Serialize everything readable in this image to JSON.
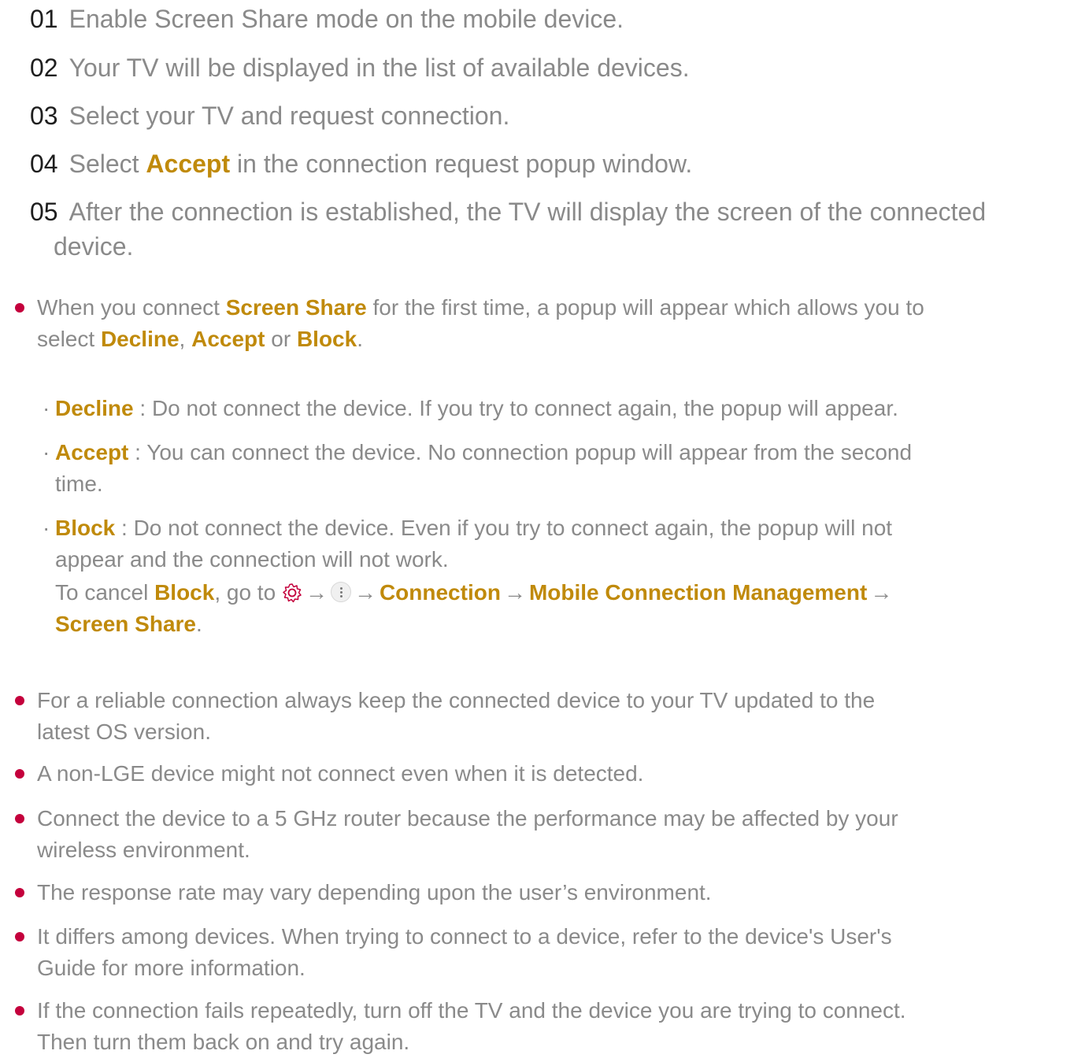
{
  "steps": [
    {
      "num": "01",
      "text": "Enable Screen Share mode on the mobile device."
    },
    {
      "num": "02",
      "text": "Your TV will be displayed in the list of available devices."
    },
    {
      "num": "03",
      "text": "Select your TV and request connection."
    },
    {
      "num": "04",
      "pre": "Select ",
      "bold": "Accept",
      "post": " in the connection request popup window."
    },
    {
      "num": "05",
      "line1": "After the connection is established, the TV will display the screen of the connected",
      "line2": "device."
    }
  ],
  "first_time_note": {
    "pre": "When you connect ",
    "b1": "Screen Share",
    "mid1": " for the first time, a popup will appear which allows you to",
    "mid2": "select ",
    "b2": "Decline",
    "sep1": ", ",
    "b3": "Accept",
    "sep2": " or ",
    "b4": "Block",
    "end": "."
  },
  "options": [
    {
      "term": "Decline",
      "desc": " : Do not connect the device. If you try to connect again, the popup will appear."
    },
    {
      "term": "Accept",
      "desc": " : You can connect the device. No connection popup will appear from the second",
      "desc2": "time."
    },
    {
      "term": "Block",
      "desc": " : Do not connect the device. Even if you try to connect again, the popup will not",
      "desc2": "appear and the connection will not work."
    }
  ],
  "cancel_block": {
    "pre": "To cancel ",
    "b1": "Block",
    "mid": ", go to ",
    "arrow": "→",
    "b2": "Connection",
    "b3": "Mobile Connection Management",
    "b4": "Screen Share",
    "end": "."
  },
  "notes": [
    {
      "l1": "For a reliable connection always keep the connected device to your TV updated to the",
      "l2": "latest OS version."
    },
    {
      "l1": "A non-LGE device might not connect even when it is detected."
    },
    {
      "l1": "Connect the device to a 5 GHz router because the performance may be affected by your",
      "l2": "wireless environment."
    },
    {
      "l1": "The response rate may vary depending upon the user’s environment."
    },
    {
      "l1": "It differs among devices. When trying to connect to a device, refer to the device's User's",
      "l2": "Guide for more information."
    },
    {
      "l1": "If the connection fails repeatedly, turn off the TV and the device you are trying to connect.",
      "l2": "Then turn them back on and try again."
    }
  ],
  "colors": {
    "accent": "#c08a0b",
    "bullet": "#c4003c",
    "text": "#8a8a8a",
    "number": "#1e1e1e"
  },
  "icons": {
    "settings": "gear-icon",
    "more": "more-icon"
  }
}
